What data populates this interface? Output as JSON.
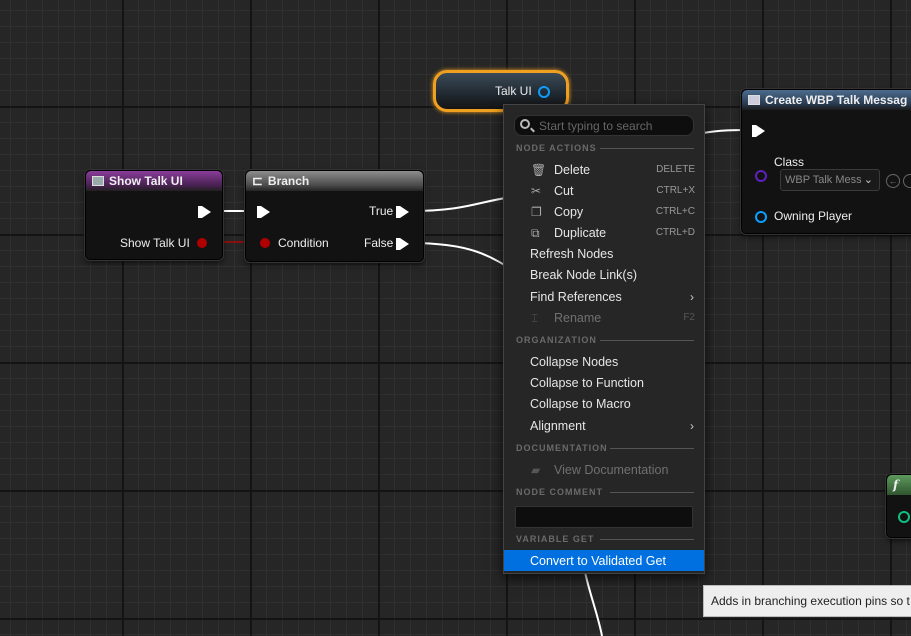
{
  "colors": {
    "exec_pin": "#ffffff",
    "bool_pin": "#a00000",
    "object_pin": "#0aa0ff",
    "class_pin": "#6020c0",
    "selection_outline": "#f0a020",
    "menu_highlight": "#0070e0"
  },
  "nodes": {
    "show_talk_ui": {
      "title": "Show Talk UI",
      "pin_label": "Show Talk UI"
    },
    "branch": {
      "title": "Branch",
      "condition_label": "Condition",
      "true_label": "True",
      "false_label": "False"
    },
    "talk_ui_get": {
      "label": "Talk UI"
    },
    "create_widget": {
      "title": "Create WBP Talk Messag",
      "class_label": "Class",
      "class_value": "WBP Talk Mess",
      "owning_label": "Owning Player"
    },
    "function_node": {
      "icon_glyph": "f"
    }
  },
  "menu": {
    "search_placeholder": "Start typing to search",
    "sections": {
      "node_actions": "NODE ACTIONS",
      "organization": "ORGANIZATION",
      "documentation": "DOCUMENTATION",
      "node_comment": "NODE COMMENT",
      "variable_get": "VARIABLE GET"
    },
    "items": {
      "delete": {
        "label": "Delete",
        "shortcut": "DELETE",
        "icon": "trash-icon"
      },
      "cut": {
        "label": "Cut",
        "shortcut": "CTRL+X",
        "icon": "scissors-icon"
      },
      "copy": {
        "label": "Copy",
        "shortcut": "CTRL+C",
        "icon": "copy-icon"
      },
      "duplicate": {
        "label": "Duplicate",
        "shortcut": "CTRL+D",
        "icon": "duplicate-icon"
      },
      "refresh": {
        "label": "Refresh Nodes"
      },
      "break_links": {
        "label": "Break Node Link(s)"
      },
      "find_refs": {
        "label": "Find References"
      },
      "rename": {
        "label": "Rename",
        "shortcut": "F2",
        "icon": "rename-icon"
      },
      "collapse_nodes": {
        "label": "Collapse Nodes"
      },
      "collapse_function": {
        "label": "Collapse to Function"
      },
      "collapse_macro": {
        "label": "Collapse to Macro"
      },
      "alignment": {
        "label": "Alignment"
      },
      "view_doc": {
        "label": "View Documentation",
        "icon": "book-icon"
      },
      "convert": {
        "label": "Convert to Validated Get"
      }
    }
  },
  "tooltip": {
    "text": "Adds in branching execution pins so t"
  }
}
